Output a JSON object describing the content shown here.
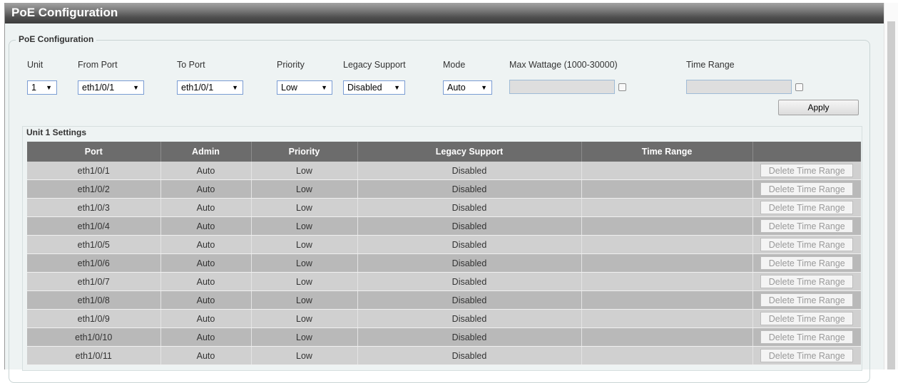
{
  "page": {
    "title": "PoE Configuration"
  },
  "form": {
    "legend": "PoE Configuration",
    "unit": {
      "label": "Unit",
      "value": "1"
    },
    "from_port": {
      "label": "From Port",
      "value": "eth1/0/1"
    },
    "to_port": {
      "label": "To Port",
      "value": "eth1/0/1"
    },
    "priority": {
      "label": "Priority",
      "value": "Low"
    },
    "legacy_support": {
      "label": "Legacy Support",
      "value": "Disabled"
    },
    "mode": {
      "label": "Mode",
      "value": "Auto"
    },
    "max_wattage": {
      "label": "Max Wattage (1000-30000)",
      "value": ""
    },
    "time_range": {
      "label": "Time Range",
      "value": ""
    },
    "apply_label": "Apply"
  },
  "table": {
    "caption": "Unit 1 Settings",
    "columns": [
      "Port",
      "Admin",
      "Priority",
      "Legacy Support",
      "Time Range",
      ""
    ],
    "delete_label": "Delete Time Range",
    "rows": [
      {
        "port": "eth1/0/1",
        "admin": "Auto",
        "priority": "Low",
        "legacy": "Disabled",
        "time_range": ""
      },
      {
        "port": "eth1/0/2",
        "admin": "Auto",
        "priority": "Low",
        "legacy": "Disabled",
        "time_range": ""
      },
      {
        "port": "eth1/0/3",
        "admin": "Auto",
        "priority": "Low",
        "legacy": "Disabled",
        "time_range": ""
      },
      {
        "port": "eth1/0/4",
        "admin": "Auto",
        "priority": "Low",
        "legacy": "Disabled",
        "time_range": ""
      },
      {
        "port": "eth1/0/5",
        "admin": "Auto",
        "priority": "Low",
        "legacy": "Disabled",
        "time_range": ""
      },
      {
        "port": "eth1/0/6",
        "admin": "Auto",
        "priority": "Low",
        "legacy": "Disabled",
        "time_range": ""
      },
      {
        "port": "eth1/0/7",
        "admin": "Auto",
        "priority": "Low",
        "legacy": "Disabled",
        "time_range": ""
      },
      {
        "port": "eth1/0/8",
        "admin": "Auto",
        "priority": "Low",
        "legacy": "Disabled",
        "time_range": ""
      },
      {
        "port": "eth1/0/9",
        "admin": "Auto",
        "priority": "Low",
        "legacy": "Disabled",
        "time_range": ""
      },
      {
        "port": "eth1/0/10",
        "admin": "Auto",
        "priority": "Low",
        "legacy": "Disabled",
        "time_range": ""
      },
      {
        "port": "eth1/0/11",
        "admin": "Auto",
        "priority": "Low",
        "legacy": "Disabled",
        "time_range": ""
      }
    ]
  },
  "icons": {
    "dropdown_arrow": "▼"
  }
}
